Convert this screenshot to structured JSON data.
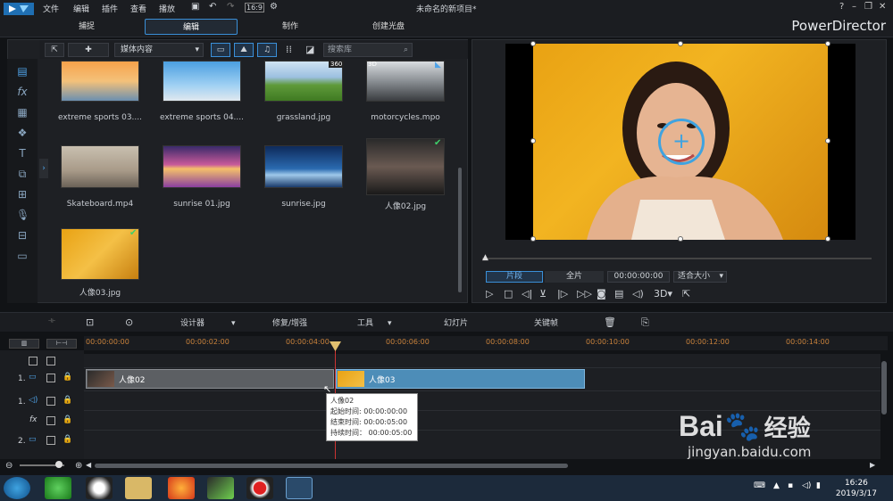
{
  "menu": [
    "文件",
    "编辑",
    "插件",
    "查看",
    "播放"
  ],
  "window": {
    "title": "未命名的新项目*",
    "help": "?"
  },
  "tabs": [
    "捕捉",
    "编辑",
    "制作",
    "创建光盘"
  ],
  "brand": "PowerDirector",
  "library": {
    "media_select": "媒体内容",
    "search_placeholder": "搜索库",
    "items": [
      {
        "name": "extreme sports 03....",
        "checked": false
      },
      {
        "name": "extreme sports 04....",
        "checked": false
      },
      {
        "name": "grassland.jpg",
        "badge": "360",
        "checked": false
      },
      {
        "name": "motorcycles.mpo",
        "badge": "3D",
        "checked": false
      },
      {
        "name": "Skateboard.mp4",
        "checked": false
      },
      {
        "name": "sunrise 01.jpg",
        "checked": false
      },
      {
        "name": "sunrise.jpg",
        "checked": false
      },
      {
        "name": "人像02.jpg",
        "checked": true
      },
      {
        "name": "人像03.jpg",
        "checked": true
      }
    ]
  },
  "preview": {
    "segment": "片段",
    "full": "全片",
    "timecode": "00:00:00:00",
    "fit": "适合大小",
    "mode3d": "3D"
  },
  "edit_toolbar": {
    "designer": "设计器",
    "repair": "修复/增强",
    "tools": "工具",
    "slideshow": "幻灯片",
    "keyframe": "关键帧"
  },
  "ruler": [
    "00:00:00:00",
    "00:00:02:00",
    "00:00:04:00",
    "00:00:06:00",
    "00:00:08:00",
    "00:00:10:00",
    "00:00:12:00",
    "00:00:14:00"
  ],
  "tracks": {
    "track1_label": "1.",
    "track2_label": "2.",
    "fx_label": "fx"
  },
  "clips": [
    {
      "label": "人像02"
    },
    {
      "label": "人像03"
    }
  ],
  "tooltip": {
    "name": "人像02",
    "start": "起始时间: 00:00:00:00",
    "end": "结束时间: 00:00:05:00",
    "duration": "持续时间：  00:00:05:00"
  },
  "clock": {
    "time": "16:26",
    "date": "2019/3/17"
  },
  "watermark": {
    "brand": "Bai",
    "suffix": "经验",
    "url": "jingyan.baidu.com"
  }
}
